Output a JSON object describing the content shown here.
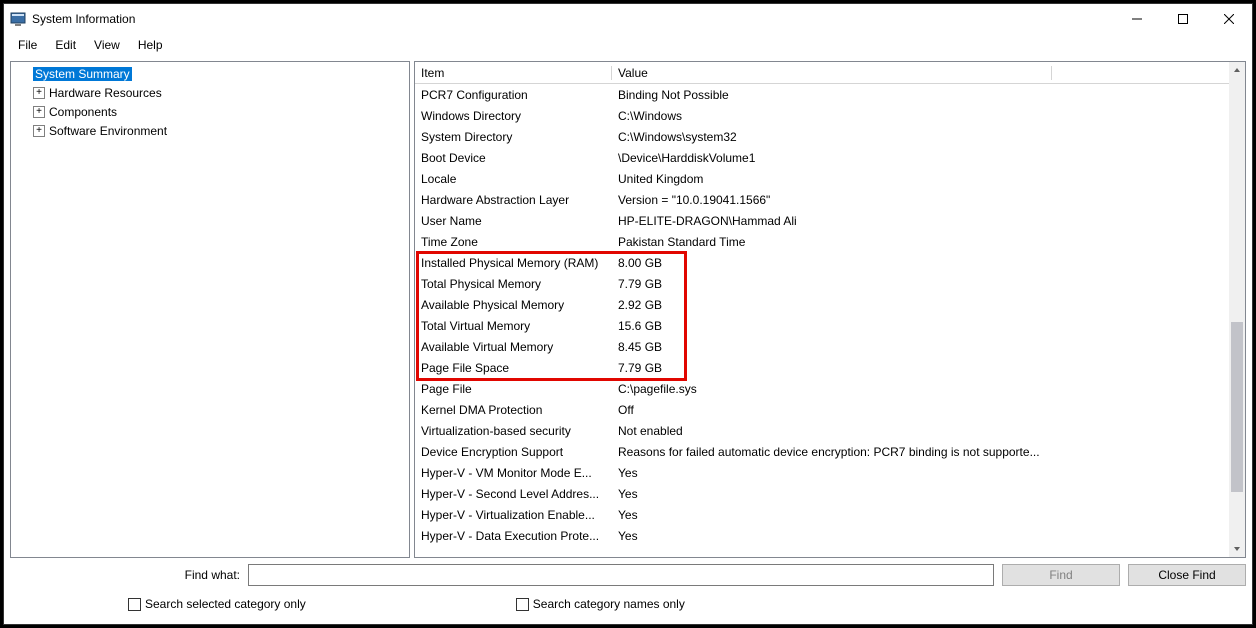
{
  "window": {
    "title": "System Information"
  },
  "menu": {
    "file": "File",
    "edit": "Edit",
    "view": "View",
    "help": "Help"
  },
  "tree": {
    "summary": "System Summary",
    "hardware": "Hardware Resources",
    "components": "Components",
    "software": "Software Environment"
  },
  "columns": {
    "item": "Item",
    "value": "Value"
  },
  "rows": [
    {
      "item": "PCR7 Configuration",
      "value": "Binding Not Possible"
    },
    {
      "item": "Windows Directory",
      "value": "C:\\Windows"
    },
    {
      "item": "System Directory",
      "value": "C:\\Windows\\system32"
    },
    {
      "item": "Boot Device",
      "value": "\\Device\\HarddiskVolume1"
    },
    {
      "item": "Locale",
      "value": "United Kingdom"
    },
    {
      "item": "Hardware Abstraction Layer",
      "value": "Version = \"10.0.19041.1566\""
    },
    {
      "item": "User Name",
      "value": "HP-ELITE-DRAGON\\Hammad Ali"
    },
    {
      "item": "Time Zone",
      "value": "Pakistan Standard Time"
    },
    {
      "item": "Installed Physical Memory (RAM)",
      "value": "8.00 GB"
    },
    {
      "item": "Total Physical Memory",
      "value": "7.79 GB"
    },
    {
      "item": "Available Physical Memory",
      "value": "2.92 GB"
    },
    {
      "item": "Total Virtual Memory",
      "value": "15.6 GB"
    },
    {
      "item": "Available Virtual Memory",
      "value": "8.45 GB"
    },
    {
      "item": "Page File Space",
      "value": "7.79 GB"
    },
    {
      "item": "Page File",
      "value": "C:\\pagefile.sys"
    },
    {
      "item": "Kernel DMA Protection",
      "value": "Off"
    },
    {
      "item": "Virtualization-based security",
      "value": "Not enabled"
    },
    {
      "item": "Device Encryption Support",
      "value": "Reasons for failed automatic device encryption: PCR7 binding is not supporte..."
    },
    {
      "item": "Hyper-V - VM Monitor Mode E...",
      "value": "Yes"
    },
    {
      "item": "Hyper-V - Second Level Addres...",
      "value": "Yes"
    },
    {
      "item": "Hyper-V - Virtualization Enable...",
      "value": "Yes"
    },
    {
      "item": "Hyper-V - Data Execution Prote...",
      "value": "Yes"
    }
  ],
  "find": {
    "label": "Find what:",
    "value": "",
    "find_btn": "Find",
    "close_btn": "Close Find",
    "chk1": "Search selected category only",
    "chk2": "Search category names only"
  }
}
